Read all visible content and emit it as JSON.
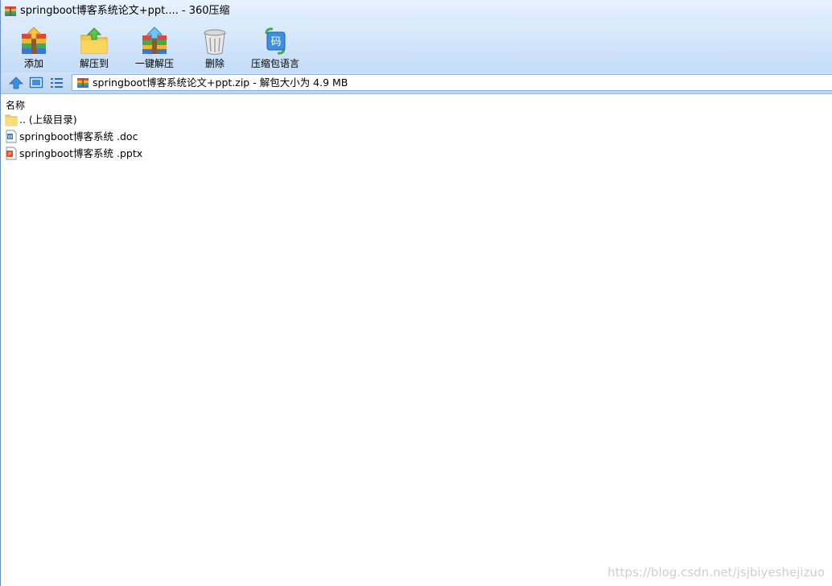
{
  "window": {
    "title": "springboot博客系统论文+ppt.... - 360压缩"
  },
  "toolbar": {
    "buttons": [
      {
        "label": "添加",
        "icon": "add-archive-icon"
      },
      {
        "label": "解压到",
        "icon": "extract-to-folder-icon"
      },
      {
        "label": "一键解压",
        "icon": "one-click-extract-icon"
      },
      {
        "label": "删除",
        "icon": "trash-can-icon"
      },
      {
        "label": "压缩包语言",
        "icon": "archive-language-icon"
      }
    ]
  },
  "nav": {
    "address_text": "springboot博客系统论文+ppt.zip - 解包大小为 4.9 MB"
  },
  "file_list": {
    "column_name": "名称",
    "rows": [
      {
        "name": ".. (上级目录)",
        "icon": "folder-icon"
      },
      {
        "name": "springboot博客系统 .doc",
        "icon": "word-document-icon"
      },
      {
        "name": "springboot博客系统 .pptx",
        "icon": "powerpoint-file-icon"
      }
    ]
  },
  "watermark": "https://blog.csdn.net/jsjbiyeshejizuo",
  "colors": {
    "toolbar_top": "#dcecfc",
    "toolbar_bottom": "#c4dcf7",
    "accent_blue": "#3d8fe0"
  }
}
